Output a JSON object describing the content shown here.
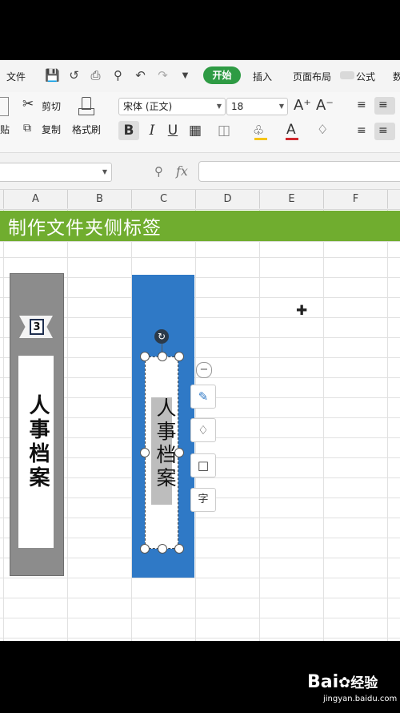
{
  "menu": {
    "file": "文件",
    "tab_start": "开始",
    "tab_insert": "插入",
    "tab_layout": "页面布局",
    "tab_formula": "公式",
    "tab_more": "数"
  },
  "ribbon": {
    "cut": "剪切",
    "copy": "复制",
    "format_painter": "格式刷",
    "paste_partial": "贴",
    "font_name": "宋体 (正文)",
    "font_size": "18",
    "grow_font": "A⁺",
    "shrink_font": "A⁻",
    "bold": "B",
    "italic": "I",
    "underline": "U"
  },
  "formula_bar": {
    "fx": "fx"
  },
  "columns": [
    "A",
    "B",
    "C",
    "D",
    "E",
    "F"
  ],
  "sheet": {
    "title": "制作文件夹侧标签",
    "label_left_number": "3",
    "label_left_text": "人事档案",
    "label_right_text": "人事档案"
  },
  "watermark": {
    "brand": "Bai",
    "brand2": "经验",
    "url": "jingyan.baidu.com"
  },
  "colors": {
    "accent_green": "#2e9b44",
    "title_green": "#70ad2f",
    "label_gray": "#8c8c8c",
    "label_blue": "#2f79c6"
  }
}
